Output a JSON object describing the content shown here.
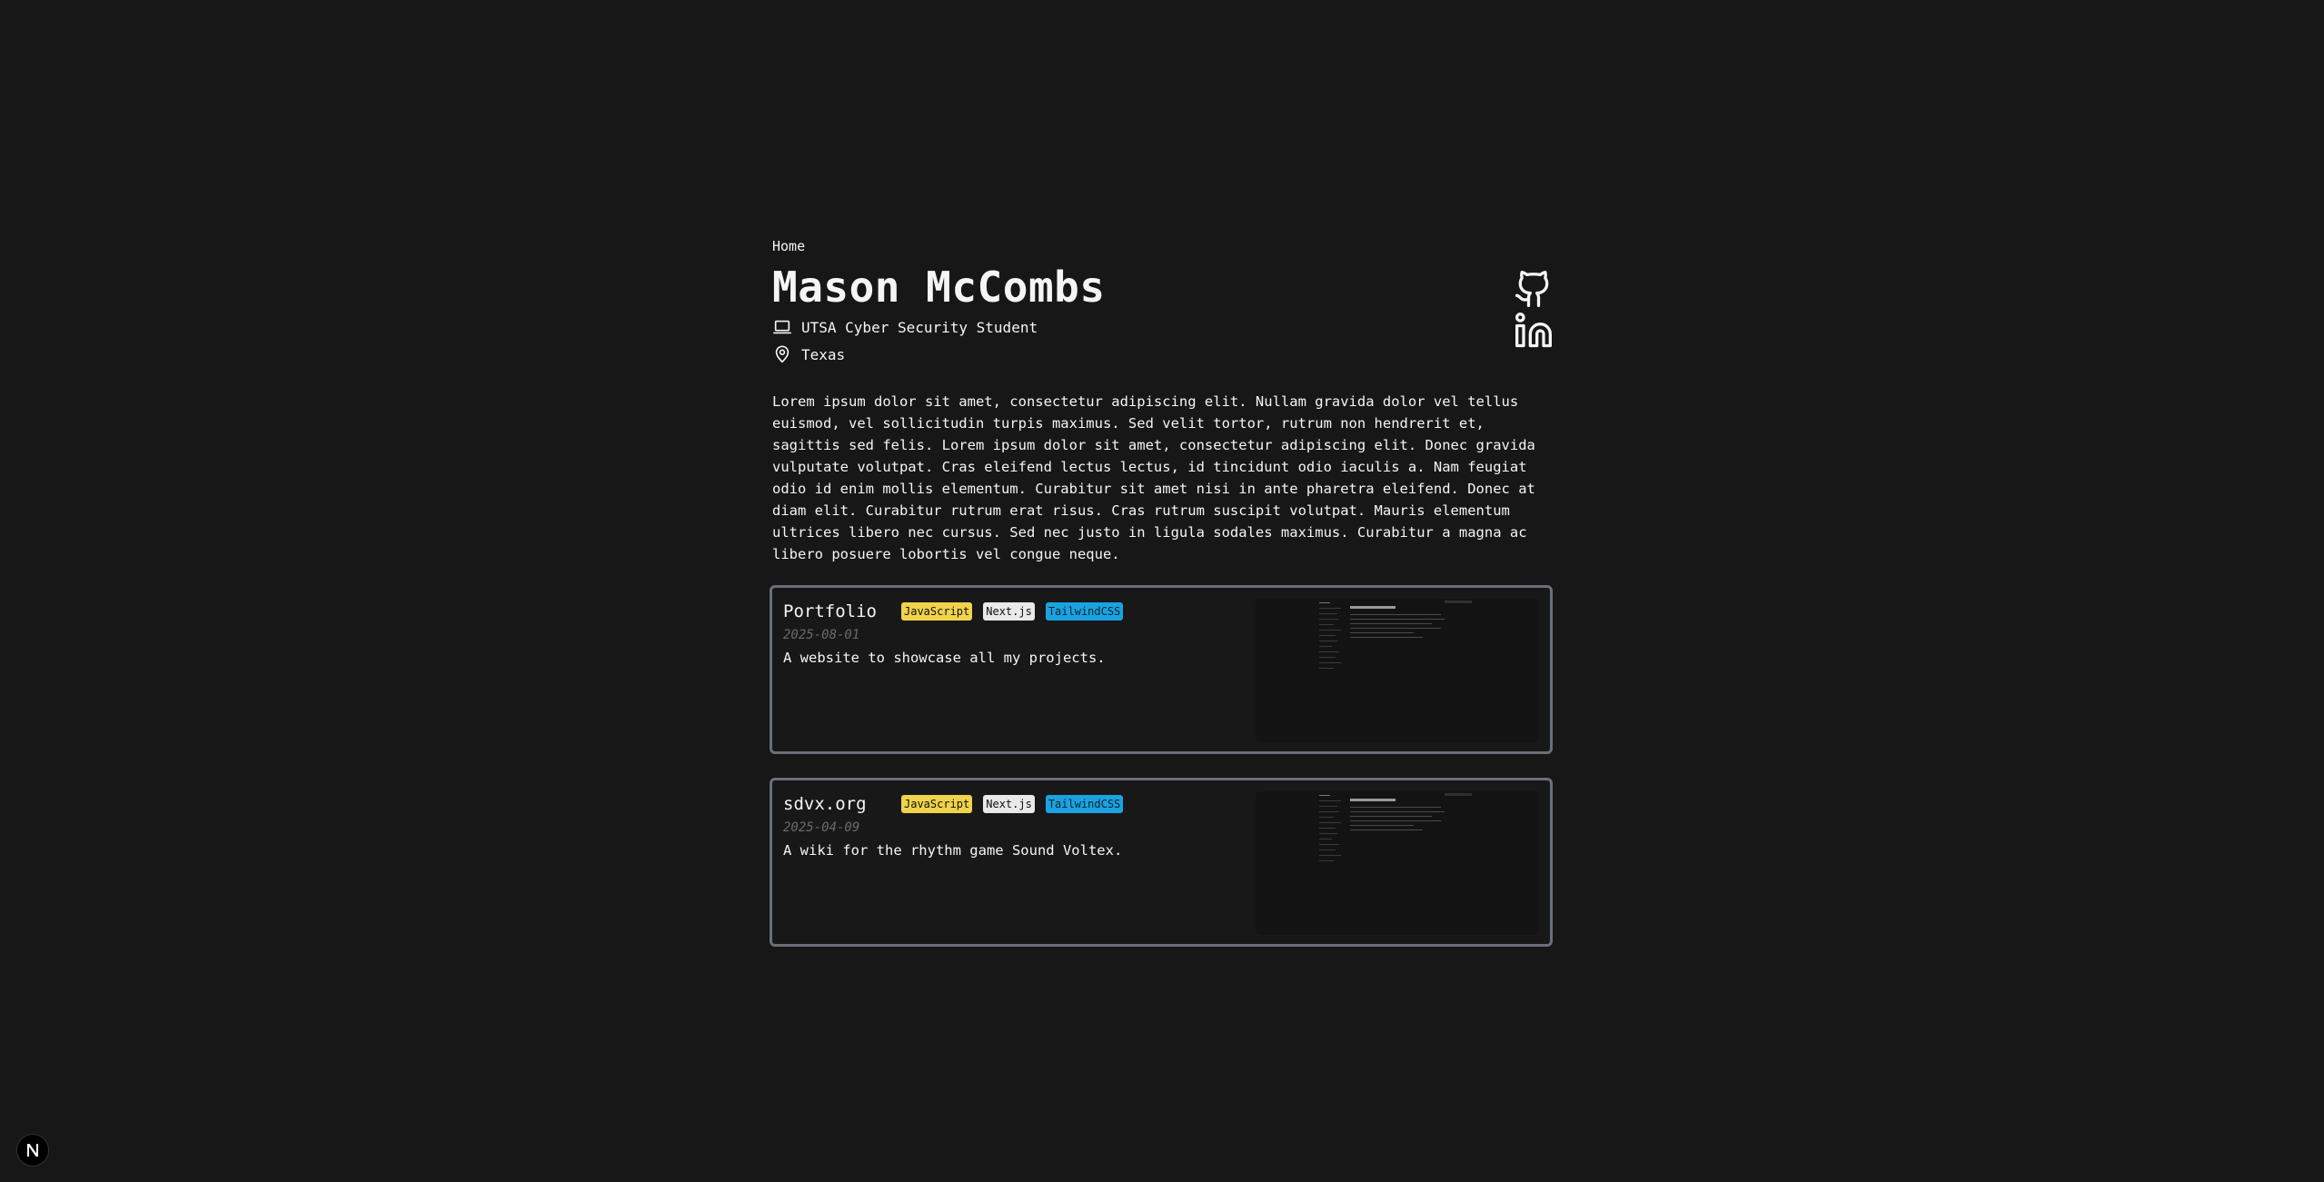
{
  "nav": {
    "home_label": "Home"
  },
  "profile": {
    "name": "Mason McCombs",
    "role": "UTSA Cyber Security Student",
    "location": "Texas",
    "bio": "Lorem ipsum dolor sit amet, consectetur adipiscing elit. Nullam gravida dolor vel tellus euismod, vel sollicitudin turpis maximus. Sed velit tortor, rutrum non hendrerit et, sagittis sed felis. Lorem ipsum dolor sit amet, consectetur adipiscing elit. Donec gravida vulputate volutpat. Cras eleifend lectus lectus, id tincidunt odio iaculis a. Nam feugiat odio id enim mollis elementum. Curabitur sit amet nisi in ante pharetra eleifend. Donec at diam elit. Curabitur rutrum erat risus. Cras rutrum suscipit volutpat. Mauris elementum ultrices libero nec cursus. Sed nec justo in ligula sodales maximus. Curabitur a magna ac libero posuere lobortis vel congue neque."
  },
  "social": {
    "icons": [
      "github-icon",
      "linkedin-icon"
    ]
  },
  "projects": [
    {
      "title": "Portfolio",
      "tags": [
        "JavaScript",
        "Next.js",
        "TailwindCSS"
      ],
      "date": "2025-08-01",
      "description": "A website to showcase all my projects."
    },
    {
      "title": "sdvx.org",
      "tags": [
        "JavaScript",
        "Next.js",
        "TailwindCSS"
      ],
      "date": "2025-04-09",
      "description": "A wiki for the rhythm game Sound Voltex."
    }
  ],
  "dev_badge": {
    "label": "N"
  },
  "colors": {
    "background": "#171717",
    "text": "#f5f5f5",
    "card_border": "#6b6f78",
    "tag_javascript": "#f0d34a",
    "tag_nextjs": "#e9e9e9",
    "tag_tailwind": "#1aa3e0",
    "date": "#6b6b6b"
  }
}
